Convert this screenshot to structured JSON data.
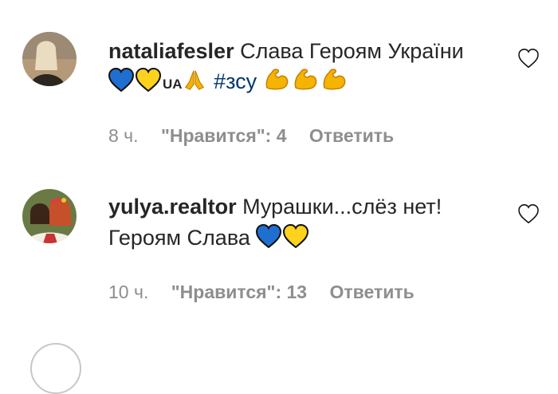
{
  "comments": [
    {
      "username": "nataliafesler",
      "text_line1": "Слава Героям України",
      "ua": "UA",
      "hashtag": "#зсу",
      "time": "8 ч.",
      "likes": "\"Нравится\": 4",
      "reply": "Ответить"
    },
    {
      "username": "yulya.realtor",
      "text_line1": "Мурашки...слёз нет!",
      "text_line2": "Героям Слава",
      "time": "10 ч.",
      "likes": "\"Нравится\": 13",
      "reply": "Ответить"
    }
  ],
  "icons": {
    "like": "heart-outline-icon",
    "emoji_blue_heart": "blue-heart-emoji",
    "emoji_yellow_heart": "yellow-heart-emoji",
    "emoji_pray": "folded-hands-emoji",
    "emoji_muscle": "flexed-biceps-emoji"
  },
  "colors": {
    "text": "#262626",
    "meta": "#8e8e8e",
    "hashtag": "#00376b",
    "blue": "#1f6fd1",
    "yellow": "#ffd21e"
  }
}
